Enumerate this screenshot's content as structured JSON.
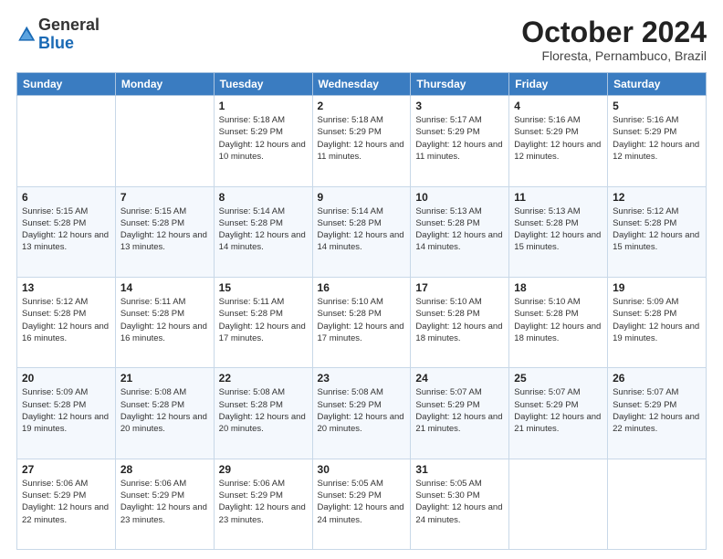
{
  "header": {
    "logo_general": "General",
    "logo_blue": "Blue",
    "month_title": "October 2024",
    "subtitle": "Floresta, Pernambuco, Brazil"
  },
  "days_of_week": [
    "Sunday",
    "Monday",
    "Tuesday",
    "Wednesday",
    "Thursday",
    "Friday",
    "Saturday"
  ],
  "weeks": [
    [
      {
        "day": "",
        "info": ""
      },
      {
        "day": "",
        "info": ""
      },
      {
        "day": "1",
        "info": "Sunrise: 5:18 AM\nSunset: 5:29 PM\nDaylight: 12 hours and 10 minutes."
      },
      {
        "day": "2",
        "info": "Sunrise: 5:18 AM\nSunset: 5:29 PM\nDaylight: 12 hours and 11 minutes."
      },
      {
        "day": "3",
        "info": "Sunrise: 5:17 AM\nSunset: 5:29 PM\nDaylight: 12 hours and 11 minutes."
      },
      {
        "day": "4",
        "info": "Sunrise: 5:16 AM\nSunset: 5:29 PM\nDaylight: 12 hours and 12 minutes."
      },
      {
        "day": "5",
        "info": "Sunrise: 5:16 AM\nSunset: 5:29 PM\nDaylight: 12 hours and 12 minutes."
      }
    ],
    [
      {
        "day": "6",
        "info": "Sunrise: 5:15 AM\nSunset: 5:28 PM\nDaylight: 12 hours and 13 minutes."
      },
      {
        "day": "7",
        "info": "Sunrise: 5:15 AM\nSunset: 5:28 PM\nDaylight: 12 hours and 13 minutes."
      },
      {
        "day": "8",
        "info": "Sunrise: 5:14 AM\nSunset: 5:28 PM\nDaylight: 12 hours and 14 minutes."
      },
      {
        "day": "9",
        "info": "Sunrise: 5:14 AM\nSunset: 5:28 PM\nDaylight: 12 hours and 14 minutes."
      },
      {
        "day": "10",
        "info": "Sunrise: 5:13 AM\nSunset: 5:28 PM\nDaylight: 12 hours and 14 minutes."
      },
      {
        "day": "11",
        "info": "Sunrise: 5:13 AM\nSunset: 5:28 PM\nDaylight: 12 hours and 15 minutes."
      },
      {
        "day": "12",
        "info": "Sunrise: 5:12 AM\nSunset: 5:28 PM\nDaylight: 12 hours and 15 minutes."
      }
    ],
    [
      {
        "day": "13",
        "info": "Sunrise: 5:12 AM\nSunset: 5:28 PM\nDaylight: 12 hours and 16 minutes."
      },
      {
        "day": "14",
        "info": "Sunrise: 5:11 AM\nSunset: 5:28 PM\nDaylight: 12 hours and 16 minutes."
      },
      {
        "day": "15",
        "info": "Sunrise: 5:11 AM\nSunset: 5:28 PM\nDaylight: 12 hours and 17 minutes."
      },
      {
        "day": "16",
        "info": "Sunrise: 5:10 AM\nSunset: 5:28 PM\nDaylight: 12 hours and 17 minutes."
      },
      {
        "day": "17",
        "info": "Sunrise: 5:10 AM\nSunset: 5:28 PM\nDaylight: 12 hours and 18 minutes."
      },
      {
        "day": "18",
        "info": "Sunrise: 5:10 AM\nSunset: 5:28 PM\nDaylight: 12 hours and 18 minutes."
      },
      {
        "day": "19",
        "info": "Sunrise: 5:09 AM\nSunset: 5:28 PM\nDaylight: 12 hours and 19 minutes."
      }
    ],
    [
      {
        "day": "20",
        "info": "Sunrise: 5:09 AM\nSunset: 5:28 PM\nDaylight: 12 hours and 19 minutes."
      },
      {
        "day": "21",
        "info": "Sunrise: 5:08 AM\nSunset: 5:28 PM\nDaylight: 12 hours and 20 minutes."
      },
      {
        "day": "22",
        "info": "Sunrise: 5:08 AM\nSunset: 5:28 PM\nDaylight: 12 hours and 20 minutes."
      },
      {
        "day": "23",
        "info": "Sunrise: 5:08 AM\nSunset: 5:29 PM\nDaylight: 12 hours and 20 minutes."
      },
      {
        "day": "24",
        "info": "Sunrise: 5:07 AM\nSunset: 5:29 PM\nDaylight: 12 hours and 21 minutes."
      },
      {
        "day": "25",
        "info": "Sunrise: 5:07 AM\nSunset: 5:29 PM\nDaylight: 12 hours and 21 minutes."
      },
      {
        "day": "26",
        "info": "Sunrise: 5:07 AM\nSunset: 5:29 PM\nDaylight: 12 hours and 22 minutes."
      }
    ],
    [
      {
        "day": "27",
        "info": "Sunrise: 5:06 AM\nSunset: 5:29 PM\nDaylight: 12 hours and 22 minutes."
      },
      {
        "day": "28",
        "info": "Sunrise: 5:06 AM\nSunset: 5:29 PM\nDaylight: 12 hours and 23 minutes."
      },
      {
        "day": "29",
        "info": "Sunrise: 5:06 AM\nSunset: 5:29 PM\nDaylight: 12 hours and 23 minutes."
      },
      {
        "day": "30",
        "info": "Sunrise: 5:05 AM\nSunset: 5:29 PM\nDaylight: 12 hours and 24 minutes."
      },
      {
        "day": "31",
        "info": "Sunrise: 5:05 AM\nSunset: 5:30 PM\nDaylight: 12 hours and 24 minutes."
      },
      {
        "day": "",
        "info": ""
      },
      {
        "day": "",
        "info": ""
      }
    ]
  ]
}
